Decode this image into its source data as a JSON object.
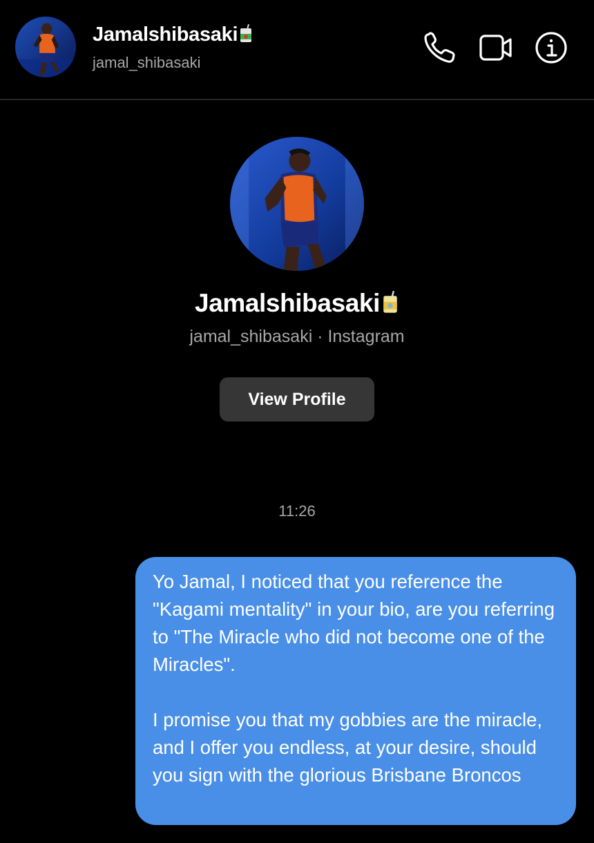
{
  "header": {
    "name": "Jamalshibasaki",
    "username": "jamal_shibasaki"
  },
  "icons": {
    "call": "phone-icon",
    "video": "video-camera-icon",
    "info": "info-icon",
    "name_emoji": "juice-box-emoji"
  },
  "profile": {
    "name": "Jamalshibasaki",
    "subtitle": "jamal_shibasaki · Instagram",
    "view_profile_label": "View Profile"
  },
  "conversation": {
    "timestamp": "11:26",
    "messages": [
      {
        "from": "me",
        "paragraphs": [
          "Yo Jamal, I noticed that you reference the \"Kagami mentality\" in your bio, are you referring to \"The Miracle who did not become one of the Miracles\".",
          "I promise you that my gobbies are the miracle, and I offer you endless, at your desire, should you sign with the glorious Brisbane Broncos"
        ]
      }
    ]
  },
  "colors": {
    "background": "#000000",
    "bubble": "#4a8fe7",
    "button": "#363636",
    "secondary_text": "#a8a8a8"
  }
}
